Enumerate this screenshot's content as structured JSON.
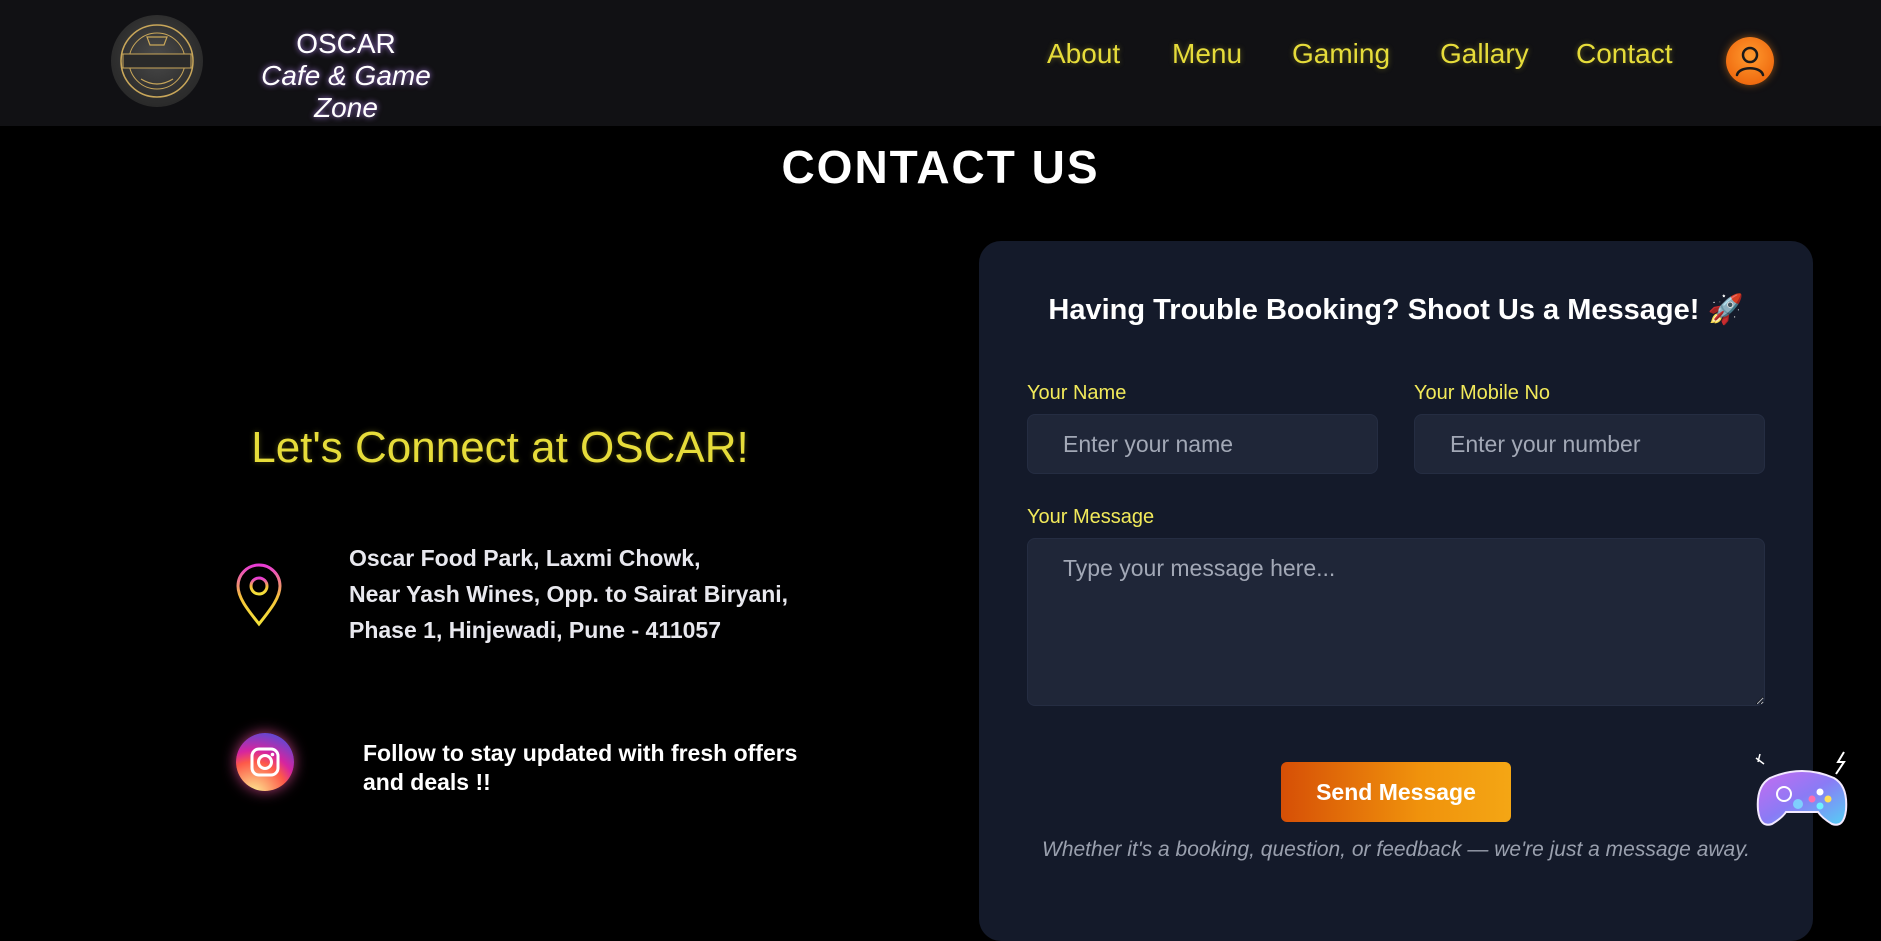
{
  "brand": {
    "title": "OSCAR",
    "subtitle": "Cafe & Game Zone",
    "logo_text": "THE OSCAR CAFE"
  },
  "nav": {
    "links": [
      {
        "label": "About"
      },
      {
        "label": "Menu"
      },
      {
        "label": "Gaming"
      },
      {
        "label": "Gallary"
      },
      {
        "label": "Contact"
      }
    ],
    "profile_icon": "user-icon"
  },
  "page": {
    "title": "CONTACT US"
  },
  "info": {
    "heading": "Let's Connect at OSCAR!",
    "address_lines": [
      "Oscar Food Park, Laxmi Chowk,",
      "Near Yash Wines, Opp. to Sairat Biryani,",
      "Phase 1, Hinjewadi, Pune - 411057"
    ],
    "address_icon": "location-pin-icon",
    "social_icon": "instagram-icon",
    "follow_text": "Follow to stay updated with fresh offers and deals !!"
  },
  "form": {
    "title": "Having Trouble Booking? Shoot Us a Message! 🚀",
    "name_label": "Your Name",
    "name_placeholder": "Enter your name",
    "name_value": "",
    "mobile_label": "Your Mobile No",
    "mobile_placeholder": "Enter your number",
    "mobile_value": "",
    "message_label": "Your Message",
    "message_placeholder": "Type your message here...",
    "message_value": "",
    "submit_label": "Send Message",
    "note": "Whether it's a booking, question, or feedback — we're just a message away."
  },
  "floating": {
    "icon": "game-controller-icon"
  },
  "colors": {
    "accent_yellow": "#e6dc3a",
    "label_yellow": "#f2ea5a",
    "card_bg": "#141a2a",
    "input_bg": "#1f2638",
    "button_orange": "#f0920c"
  }
}
